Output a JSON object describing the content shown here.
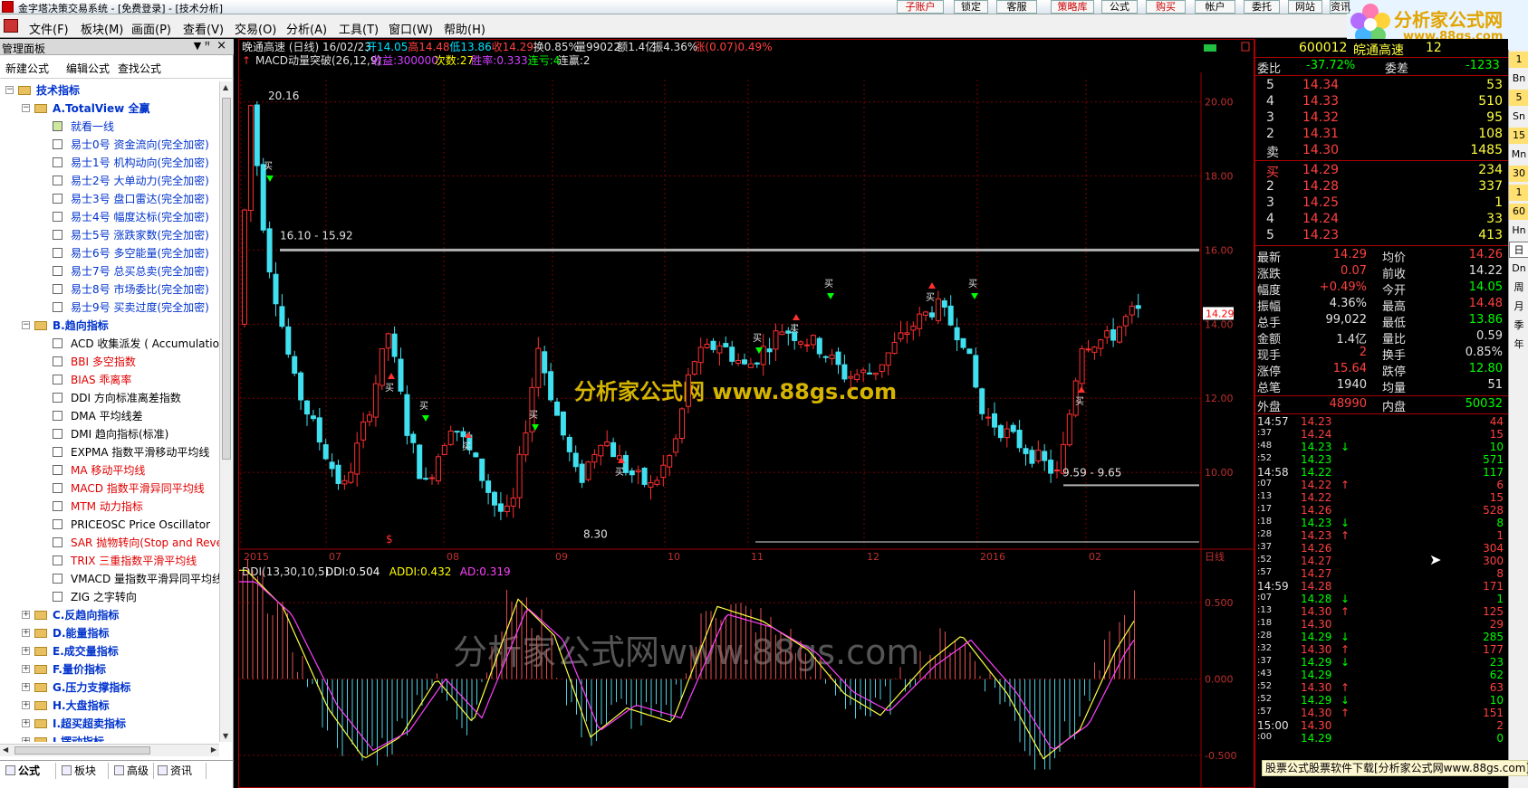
{
  "titlebar": {
    "text": "金字塔决策交易系统 - [免费登录] - [技术分析]"
  },
  "menu": {
    "items": [
      "文件(F)",
      "板块(M)",
      "画面(P)",
      "查看(V)",
      "交易(O)",
      "分析(A)",
      "工具(T)",
      "窗口(W)",
      "帮助(H)"
    ]
  },
  "toolbar": {
    "buttons": [
      "子账户",
      "锁定",
      "客服",
      "策略库",
      "公式",
      "购买",
      "帐户",
      "委托",
      "网站",
      "资讯"
    ]
  },
  "brand": {
    "name": "分析家公式网",
    "url": "www.88gs.com"
  },
  "left_panel": {
    "title": "管理面板",
    "tools": [
      "新建公式",
      "编辑公式",
      "查找公式"
    ],
    "tree": [
      {
        "label": "技术指标",
        "level": 0,
        "type": "folder-bold",
        "toggle": "−"
      },
      {
        "label": "A.TotalView 全赢",
        "level": 1,
        "type": "folder-bold",
        "toggle": "−"
      },
      {
        "label": "就看一线",
        "level": 2,
        "type": "blue"
      },
      {
        "label": "易士0号    资金流向(完全加密)",
        "level": 2,
        "type": "blue"
      },
      {
        "label": "易士1号    机构动向(完全加密)",
        "level": 2,
        "type": "blue"
      },
      {
        "label": "易士2号    大单动力(完全加密)",
        "level": 2,
        "type": "blue"
      },
      {
        "label": "易士3号    盘口雷达(完全加密)",
        "level": 2,
        "type": "blue"
      },
      {
        "label": "易士4号    幅度达标(完全加密)",
        "level": 2,
        "type": "blue"
      },
      {
        "label": "易士5号    涨跌家数(完全加密)",
        "level": 2,
        "type": "blue"
      },
      {
        "label": "易士6号    多空能量(完全加密)",
        "level": 2,
        "type": "blue"
      },
      {
        "label": "易士7号    总买总卖(完全加密)",
        "level": 2,
        "type": "blue"
      },
      {
        "label": "易士8号    市场委比(完全加密)",
        "level": 2,
        "type": "blue"
      },
      {
        "label": "易士9号    买卖过度(完全加密)",
        "level": 2,
        "type": "blue"
      },
      {
        "label": "B.趋向指标",
        "level": 1,
        "type": "folder-bold",
        "toggle": "−"
      },
      {
        "label": "ACD 收集派发 ( Accumulation",
        "level": 2,
        "type": "black"
      },
      {
        "label": "BBI 多空指数",
        "level": 2,
        "type": "red"
      },
      {
        "label": "BIAS 乖离率",
        "level": 2,
        "type": "red"
      },
      {
        "label": "DDI 方向标准离差指数",
        "level": 2,
        "type": "black"
      },
      {
        "label": "DMA 平均线差",
        "level": 2,
        "type": "black"
      },
      {
        "label": "DMI 趋向指标(标准)",
        "level": 2,
        "type": "black"
      },
      {
        "label": "EXPMA 指数平滑移动平均线",
        "level": 2,
        "type": "black"
      },
      {
        "label": "MA 移动平均线",
        "level": 2,
        "type": "red"
      },
      {
        "label": "MACD 指数平滑异同平均线",
        "level": 2,
        "type": "red"
      },
      {
        "label": "MTM 动力指标",
        "level": 2,
        "type": "red"
      },
      {
        "label": "PRICEOSC Price Oscillator",
        "level": 2,
        "type": "black"
      },
      {
        "label": "SAR 抛物转向(Stop and Reve",
        "level": 2,
        "type": "red"
      },
      {
        "label": "TRIX 三重指数平滑平均线",
        "level": 2,
        "type": "red"
      },
      {
        "label": "VMACD 量指数平滑异同平均线",
        "level": 2,
        "type": "black"
      },
      {
        "label": "ZIG 之字转向",
        "level": 2,
        "type": "black"
      },
      {
        "label": "C.反趋向指标",
        "level": 1,
        "type": "folder-bold",
        "toggle": "+"
      },
      {
        "label": "D.能量指标",
        "level": 1,
        "type": "folder-bold",
        "toggle": "+"
      },
      {
        "label": "E.成交量指标",
        "level": 1,
        "type": "folder-bold",
        "toggle": "+"
      },
      {
        "label": "F.量价指标",
        "level": 1,
        "type": "folder-bold",
        "toggle": "+"
      },
      {
        "label": "G.压力支撑指标",
        "level": 1,
        "type": "folder-bold",
        "toggle": "+"
      },
      {
        "label": "H.大盘指标",
        "level": 1,
        "type": "folder-bold",
        "toggle": "+"
      },
      {
        "label": "I.超买超卖指标",
        "level": 1,
        "type": "folder-bold",
        "toggle": "+"
      },
      {
        "label": "J.摆动指标",
        "level": 1,
        "type": "folder-bold",
        "toggle": "+"
      }
    ],
    "tabs": [
      "公式",
      "板块",
      "高级",
      "资讯"
    ]
  },
  "main_chart": {
    "header": "晚通高速 (日线) 16/02/23",
    "ohlc": [
      {
        "label": "开14.05",
        "color": "#00e0ff"
      },
      {
        "label": "高14.48",
        "color": "#ff4040"
      },
      {
        "label": "低13.86",
        "color": "#00e0ff"
      },
      {
        "label": "收14.29",
        "color": "#ff4040"
      },
      {
        "label": "换0.85%",
        "color": "#e0e0e0"
      },
      {
        "label": "量99022",
        "color": "#e0e0e0"
      },
      {
        "label": "额1.4亿",
        "color": "#e0e0e0"
      },
      {
        "label": "振4.36%",
        "color": "#e0e0e0"
      },
      {
        "label": "涨(0.07)0.49%",
        "color": "#ff4040"
      }
    ],
    "strategy": [
      {
        "label": "MACD动量突破(26,12,9)",
        "color": "#e0e0e0"
      },
      {
        "label": "收益:300000",
        "color": "#d040ff"
      },
      {
        "label": "次数:27",
        "color": "#ffff00"
      },
      {
        "label": "胜率:0.333",
        "color": "#d040ff"
      },
      {
        "label": "连亏:4",
        "color": "#00ff00"
      },
      {
        "label": "连赢:2",
        "color": "#e0e0e0"
      }
    ],
    "annotations": [
      "20.16",
      "16.10 - 15.92",
      "8.30",
      "9.59 - 9.65"
    ],
    "watermark": "分析家公式网  www.88gs.com",
    "signal_label": "买",
    "last_price_tag": "14.29",
    "period_label": "日线"
  },
  "indicator": {
    "header": "DDI(13,30,10,5)",
    "values": [
      {
        "label": "DDI:0.504",
        "color": "#ffffff"
      },
      {
        "label": "ADDI:0.432",
        "color": "#ffff00"
      },
      {
        "label": "AD:0.319",
        "color": "#ff40ff"
      }
    ],
    "watermark": "分析家公式网www.88gs.com"
  },
  "chart_data": [
    {
      "type": "candlestick",
      "title": "晚通高速 (日线)",
      "ylim": [
        8,
        20.6
      ],
      "yticks": [
        "20.00",
        "18.00",
        "16.00",
        "14.00",
        "12.00",
        "10.00"
      ],
      "xticks": [
        "2015",
        "07",
        "08",
        "09",
        "10",
        "11",
        "12",
        "2016",
        "02"
      ],
      "last": {
        "date": "16/02/23",
        "open": 14.05,
        "high": 14.48,
        "low": 13.86,
        "close": 14.29
      }
    },
    {
      "type": "line",
      "title": "DDI(13,30,10,5)",
      "ylim": [
        -0.72,
        0.75
      ],
      "yticks": [
        "0.500",
        "0.000",
        "-0.500"
      ],
      "series": [
        {
          "name": "DDI",
          "last": 0.504
        },
        {
          "name": "ADDI",
          "last": 0.432
        },
        {
          "name": "AD",
          "last": 0.319
        }
      ]
    }
  ],
  "quote": {
    "code": "600012",
    "name": "皖通高速",
    "num": "12",
    "weibi_label": "委比",
    "weibi": "-37.72%",
    "weicha_label": "委差",
    "weicha": "-1233",
    "sell": [
      {
        "l": "5",
        "p": "14.34",
        "v": "53"
      },
      {
        "l": "4",
        "p": "14.33",
        "v": "510"
      },
      {
        "l": "3",
        "p": "14.32",
        "v": "95"
      },
      {
        "l": "2",
        "p": "14.31",
        "v": "108"
      },
      {
        "l": "卖",
        "p": "14.30",
        "v": "1485"
      }
    ],
    "buy": [
      {
        "l": "买",
        "p": "14.29",
        "v": "234"
      },
      {
        "l": "2",
        "p": "14.28",
        "v": "337"
      },
      {
        "l": "3",
        "p": "14.25",
        "v": "1"
      },
      {
        "l": "4",
        "p": "14.24",
        "v": "33"
      },
      {
        "l": "5",
        "p": "14.23",
        "v": "413"
      }
    ],
    "stats": [
      {
        "k1": "最新",
        "v1": "14.29",
        "c1": "#ff4040",
        "k2": "均价",
        "v2": "14.26",
        "c2": "#ff4040"
      },
      {
        "k1": "涨跌",
        "v1": "0.07",
        "c1": "#ff4040",
        "k2": "前收",
        "v2": "14.22",
        "c2": "#e0e0e0"
      },
      {
        "k1": "幅度",
        "v1": "+0.49%",
        "c1": "#ff4040",
        "k2": "今开",
        "v2": "14.05",
        "c2": "#00ff00"
      },
      {
        "k1": "振幅",
        "v1": "4.36%",
        "c1": "#e0e0e0",
        "k2": "最高",
        "v2": "14.48",
        "c2": "#ff4040"
      },
      {
        "k1": "总手",
        "v1": "99,022",
        "c1": "#e0e0e0",
        "k2": "最低",
        "v2": "13.86",
        "c2": "#00ff00"
      },
      {
        "k1": "金额",
        "v1": "1.4亿",
        "c1": "#e0e0e0",
        "k2": "量比",
        "v2": "0.59",
        "c2": "#e0e0e0"
      },
      {
        "k1": "现手",
        "v1": "2",
        "c1": "#ff4040",
        "k2": "换手",
        "v2": "0.85%",
        "c2": "#e0e0e0"
      },
      {
        "k1": "涨停",
        "v1": "15.64",
        "c1": "#ff4040",
        "k2": "跌停",
        "v2": "12.80",
        "c2": "#00ff00"
      },
      {
        "k1": "总笔",
        "v1": "1940",
        "c1": "#e0e0e0",
        "k2": "均量",
        "v2": "51",
        "c2": "#e0e0e0"
      }
    ],
    "outer_label": "外盘",
    "outer": "48990",
    "inner_label": "内盘",
    "inner": "50032",
    "ticks": [
      {
        "t": "14:57",
        "p": "14.23",
        "a": "",
        "v": "44",
        "c": "#ff4040"
      },
      {
        "t": ":37",
        "p": "14.24",
        "a": "",
        "v": "15",
        "c": "#ff4040"
      },
      {
        "t": ":48",
        "p": "14.23",
        "a": "↓",
        "v": "10",
        "c": "#00ff00"
      },
      {
        "t": ":52",
        "p": "14.23",
        "a": "",
        "v": "571",
        "c": "#00ff00"
      },
      {
        "t": "14:58",
        "p": "14.22",
        "a": "",
        "v": "117",
        "c": "#00ff00"
      },
      {
        "t": ":07",
        "p": "14.22",
        "a": "↑",
        "v": "6",
        "c": "#ff4040"
      },
      {
        "t": ":13",
        "p": "14.22",
        "a": "",
        "v": "15",
        "c": "#ff4040"
      },
      {
        "t": ":17",
        "p": "14.26",
        "a": "",
        "v": "528",
        "c": "#ff4040"
      },
      {
        "t": ":18",
        "p": "14.23",
        "a": "↓",
        "v": "8",
        "c": "#00ff00"
      },
      {
        "t": ":28",
        "p": "14.23",
        "a": "↑",
        "v": "1",
        "c": "#ff4040"
      },
      {
        "t": ":37",
        "p": "14.26",
        "a": "",
        "v": "304",
        "c": "#ff4040"
      },
      {
        "t": ":52",
        "p": "14.27",
        "a": "",
        "v": "300",
        "c": "#ff4040"
      },
      {
        "t": ":57",
        "p": "14.27",
        "a": "",
        "v": "8",
        "c": "#ff4040"
      },
      {
        "t": "14:59",
        "p": "14.28",
        "a": "",
        "v": "171",
        "c": "#ff4040"
      },
      {
        "t": ":07",
        "p": "14.28",
        "a": "↓",
        "v": "1",
        "c": "#00ff00"
      },
      {
        "t": ":13",
        "p": "14.30",
        "a": "↑",
        "v": "125",
        "c": "#ff4040"
      },
      {
        "t": ":18",
        "p": "14.30",
        "a": "",
        "v": "29",
        "c": "#ff4040"
      },
      {
        "t": ":28",
        "p": "14.29",
        "a": "↓",
        "v": "285",
        "c": "#00ff00"
      },
      {
        "t": ":32",
        "p": "14.30",
        "a": "↑",
        "v": "177",
        "c": "#ff4040"
      },
      {
        "t": ":37",
        "p": "14.29",
        "a": "↓",
        "v": "23",
        "c": "#00ff00"
      },
      {
        "t": ":43",
        "p": "14.29",
        "a": "",
        "v": "62",
        "c": "#00ff00"
      },
      {
        "t": ":52",
        "p": "14.30",
        "a": "↑",
        "v": "63",
        "c": "#ff4040"
      },
      {
        "t": ":52",
        "p": "14.29",
        "a": "↓",
        "v": "10",
        "c": "#00ff00"
      },
      {
        "t": ":57",
        "p": "14.30",
        "a": "↑",
        "v": "151",
        "c": "#ff4040"
      },
      {
        "t": "15:00",
        "p": "14.30",
        "a": "",
        "v": "2",
        "c": "#ff4040"
      },
      {
        "t": ":00",
        "p": "14.29",
        "a": "",
        "v": "0",
        "c": "#00ff00"
      }
    ]
  },
  "right_bar": {
    "items": [
      "1",
      "Bn",
      "5",
      "Sn",
      "15",
      "Mn",
      "30",
      "1",
      "60",
      "Hn",
      "日",
      "Dn",
      "周",
      "月",
      "季",
      "年"
    ]
  },
  "bottom_ad": "股票公式股票软件下载[分析家公式网www.88gs.com]",
  "colors": {
    "up": "#ff3030",
    "down": "#40e0f0",
    "grid": "#8a0000",
    "text": "#e0e0e0"
  }
}
